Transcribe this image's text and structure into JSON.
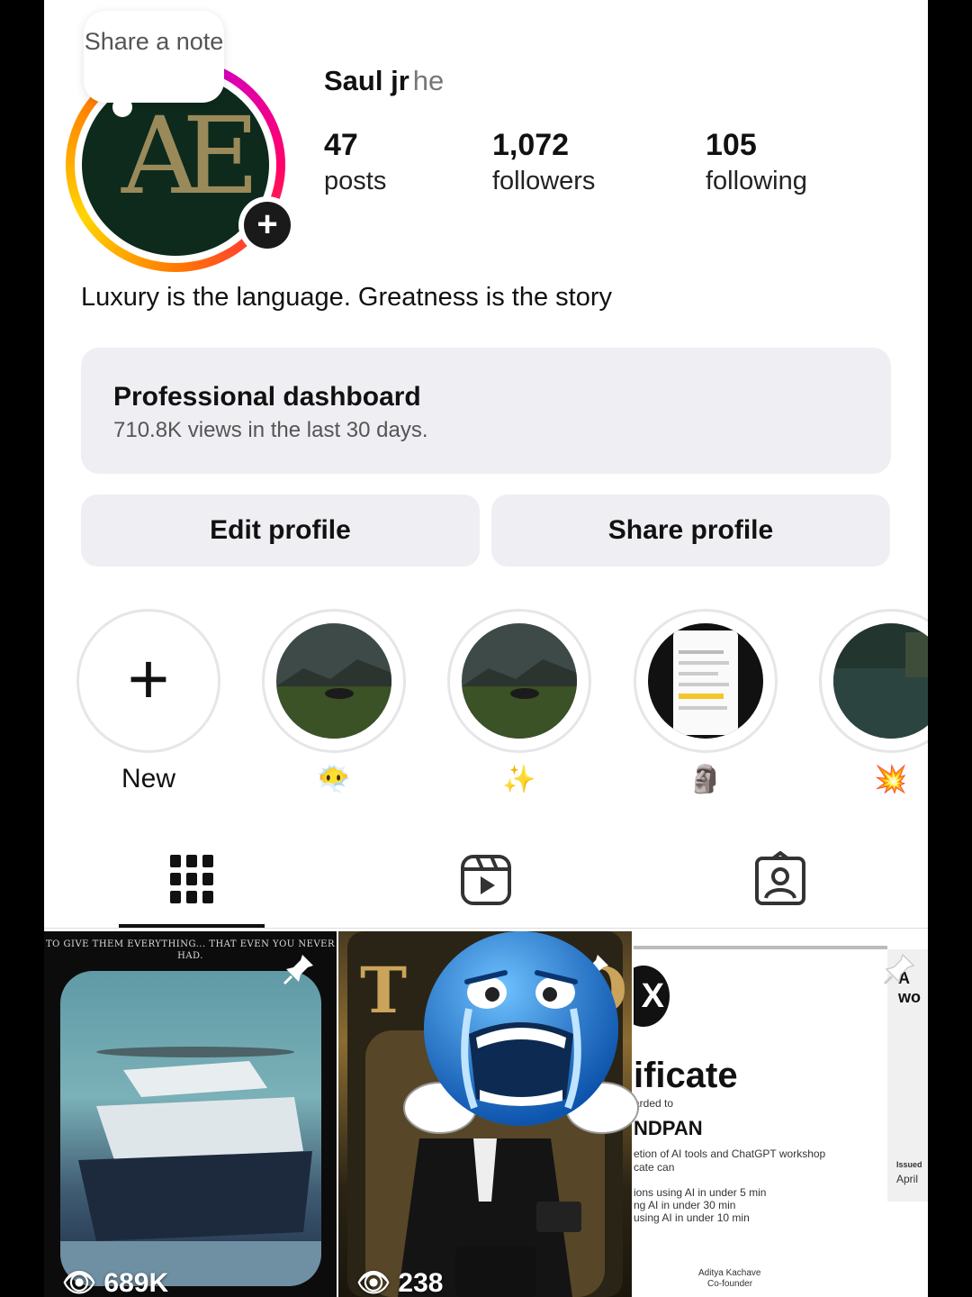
{
  "profile": {
    "note_label": "Share a note",
    "username": "Saul jr",
    "pronoun": "he",
    "avatar_text": "AE",
    "bio": "Luxury is the language. Greatness is the story"
  },
  "stats": [
    {
      "value": "47",
      "label": "posts"
    },
    {
      "value": "1,072",
      "label": "followers"
    },
    {
      "value": "105",
      "label": "following"
    }
  ],
  "dashboard": {
    "title": "Professional dashboard",
    "subtitle": "710.8K views in the last 30 days."
  },
  "buttons": {
    "edit": "Edit profile",
    "share": "Share profile"
  },
  "highlights": [
    {
      "label": "New",
      "icon": "plus-icon"
    },
    {
      "label": "😶‍🌫️",
      "icon": "helicopter-lawn"
    },
    {
      "label": "✨",
      "icon": "helicopter-lawn"
    },
    {
      "label": "🗿",
      "icon": "phone-screenshot"
    },
    {
      "label": "💥",
      "icon": "lake-view"
    }
  ],
  "tabs": [
    {
      "name": "grid",
      "icon": "grid-icon",
      "active": true
    },
    {
      "name": "reels",
      "icon": "reels-icon",
      "active": false
    },
    {
      "name": "tagged",
      "icon": "tagged-icon",
      "active": false
    }
  ],
  "posts": [
    {
      "caption": "TO GIVE THEM EVERYTHING... THAT EVEN YOU NEVER HAD.",
      "views": "689K",
      "pinned": true
    },
    {
      "views": "238",
      "pinned": true
    },
    {
      "title": "ificate",
      "awarded": "arded to",
      "name": "NDPAN",
      "line1": "etion of AI tools and ChatGPT workshop",
      "line2": "cate can",
      "line3": "ions using AI in under 5 min",
      "line4": "ng AI in under 30 min",
      "line5": "using AI in under 10 min",
      "signer": "Aditya Kachave",
      "signer_role": "Co-founder",
      "issued": "Issued",
      "issued_month": "April",
      "side_text": "A wo",
      "pinned": true
    }
  ],
  "colors": {
    "accent_ring": "#d300c5",
    "button_bg": "#efeff3",
    "text": "#111111"
  }
}
